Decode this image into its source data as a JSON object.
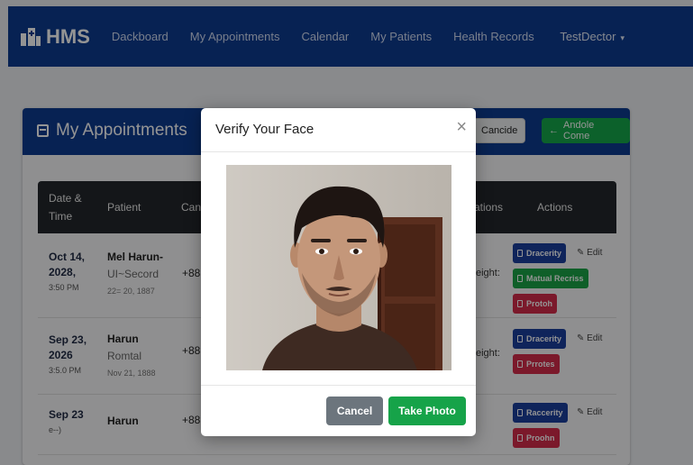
{
  "navbar": {
    "brand": "HMS",
    "links": [
      "Dackboard",
      "My Appointments",
      "Calendar",
      "My Patients",
      "Health Records"
    ],
    "user": "TestDector",
    "user_caret": "▾"
  },
  "card": {
    "title": "My Appointments",
    "btn_cancide": "Cancide",
    "btn_andole": "Andole Come",
    "btn_andole_icon": "←",
    "headers": {
      "date_line1": "Date &",
      "date_line2": "Time",
      "patient": "Patient",
      "can": "Can",
      "act": "ations",
      "actions": "Actions"
    },
    "rows": [
      {
        "date": "Oct 14,",
        "date2": "2028,",
        "time": "3:50 PM",
        "name": "Mel Harun-",
        "sub1": "UI~Secord",
        "sub2": "22= 20, 1887",
        "phone": "+88",
        "eight": "eight:",
        "tag1": "Dracerity",
        "tag2": "Matual Recriss",
        "tag3": "Protoh",
        "edit": "Edit"
      },
      {
        "date": "Sep 23,",
        "date2": "2026",
        "time": "3:5.0 PM",
        "name": "Harun",
        "sub1": "Romtal",
        "sub2": "Nov 21, 1888",
        "phone": "+88",
        "eight": "eight:",
        "tag1": "Dracerity",
        "tag2": "Prrotes",
        "edit": "Edit"
      },
      {
        "date": "Sep 23",
        "date2": "",
        "time": "e--)",
        "name": "Harun",
        "phone": "+88",
        "tag1": "Raccerity",
        "tag2": "Proohn",
        "edit": "Edit"
      }
    ]
  },
  "modal": {
    "title": "Verify Your Face",
    "close": "×",
    "cancel": "Cancel",
    "take_photo": "Take Photo"
  }
}
